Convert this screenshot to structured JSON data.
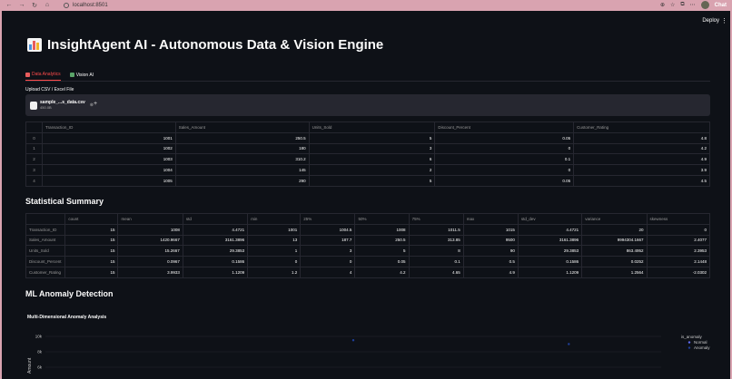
{
  "browser": {
    "url": "localhost:8501",
    "chat_label": "Chat"
  },
  "app": {
    "deploy_label": "Deploy",
    "menu_glyph": "⋮",
    "title": "InsightAgent AI - Autonomous Data & Vision Engine",
    "tabs": [
      {
        "label": "Data Analytics",
        "active": true
      },
      {
        "label": "Vision AI",
        "active": false
      }
    ],
    "upload": {
      "label": "Upload CSV / Excel File",
      "file_name": "sample_...s_data.csv",
      "file_size": "450.0B",
      "close_glyph": "⊗",
      "add_glyph": "+"
    }
  },
  "data_table": {
    "columns": [
      "",
      "Transaction_ID",
      "Sales_Amount",
      "Units_Sold",
      "Discount_Percent",
      "Customer_Rating"
    ],
    "rows": [
      [
        "0",
        "1001",
        "250.5",
        "5",
        "0.05",
        "4.8"
      ],
      [
        "1",
        "1002",
        "180",
        "3",
        "0",
        "4.2"
      ],
      [
        "2",
        "1003",
        "310.2",
        "6",
        "0.1",
        "4.9"
      ],
      [
        "3",
        "1004",
        "145",
        "2",
        "0",
        "3.9"
      ],
      [
        "4",
        "1005",
        "290",
        "5",
        "0.05",
        "4.5"
      ]
    ]
  },
  "stats": {
    "title": "Statistical Summary",
    "columns": [
      "",
      "count",
      "mean",
      "std",
      "min",
      "25%",
      "50%",
      "75%",
      "max",
      "std_dev",
      "variance",
      "skewness"
    ],
    "rows": [
      [
        "Transaction_ID",
        "15",
        "1008",
        "4.4721",
        "1001",
        "1004.5",
        "1008",
        "1011.5",
        "1015",
        "4.4721",
        "20",
        "0"
      ],
      [
        "Sales_Amount",
        "15",
        "1420.9667",
        "3161.3896",
        "13",
        "187.7",
        "250.5",
        "313.85",
        "9500",
        "3161.3896",
        "9994304.1667",
        "2.4077"
      ],
      [
        "Units_Sold",
        "15",
        "15.2667",
        "29.3853",
        "1",
        "3",
        "5",
        "8",
        "90",
        "29.3853",
        "863.4952",
        "2.3953"
      ],
      [
        "Discount_Percent",
        "15",
        "0.0967",
        "0.1586",
        "0",
        "0",
        "0.05",
        "0.1",
        "0.5",
        "0.1586",
        "0.0252",
        "2.1448"
      ],
      [
        "Customer_Rating",
        "15",
        "3.9933",
        "1.1209",
        "1.2",
        "4",
        "4.2",
        "4.65",
        "4.9",
        "1.1209",
        "1.2564",
        "-2.0302"
      ]
    ]
  },
  "ml": {
    "title": "ML Anomaly Detection",
    "chart_title": "Multi-Dimensional Anomaly Analysis"
  },
  "chart_data": {
    "type": "scatter",
    "title": "Multi-Dimensional Anomaly Analysis",
    "ylabel": "Amount",
    "yticks": [
      "10k",
      "8k",
      "6k"
    ],
    "legend_title": "is_anomaly",
    "legend": [
      {
        "name": "Normal",
        "color": "#636efa"
      },
      {
        "name": "Anomaly",
        "color": "#1f3f9a"
      }
    ],
    "legend_position": "top-right",
    "series": [
      {
        "name": "Normal",
        "points": []
      },
      {
        "name": "Anomaly",
        "points": [
          {
            "x": 0.5,
            "y": 9500
          },
          {
            "x": 0.85,
            "y": 9000
          }
        ]
      }
    ]
  }
}
